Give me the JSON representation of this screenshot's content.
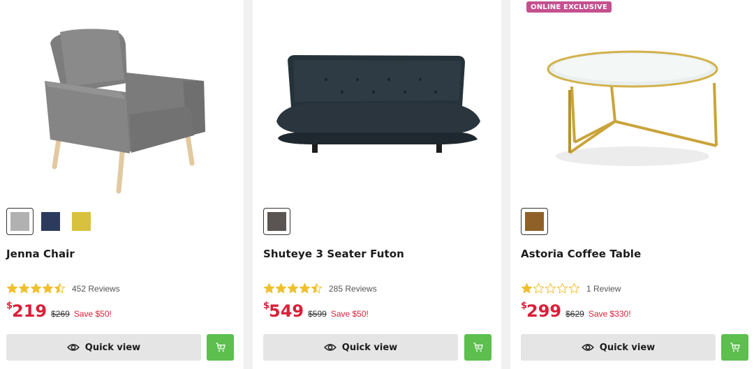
{
  "products": [
    {
      "name": "Jenna Chair",
      "badge": "",
      "swatches": [
        "#b1b1b1",
        "#2c3a5e",
        "#d8c23d"
      ],
      "selected_swatch": 0,
      "rating": 4.5,
      "reviews": "452 Reviews",
      "currency": "$",
      "price": "219",
      "was_price": "$269",
      "save": "Save $50!",
      "quick_view_label": "Quick view",
      "image_icon": "armchair-image"
    },
    {
      "name": "Shuteye 3 Seater Futon",
      "badge": "",
      "swatches": [
        "#5a5452"
      ],
      "selected_swatch": 0,
      "rating": 4.5,
      "reviews": "285 Reviews",
      "currency": "$",
      "price": "549",
      "was_price": "$599",
      "save": "Save $50!",
      "quick_view_label": "Quick view",
      "image_icon": "futon-image"
    },
    {
      "name": "Astoria Coffee Table",
      "badge": "ONLINE EXCLUSIVE",
      "swatches": [
        "#8f6128"
      ],
      "selected_swatch": 0,
      "rating": 1,
      "reviews": "1 Review",
      "currency": "$",
      "price": "299",
      "was_price": "$629",
      "save": "Save $330!",
      "quick_view_label": "Quick view",
      "image_icon": "coffee-table-image"
    }
  ],
  "colors": {
    "price": "#d9213a",
    "badge": "#c5508e",
    "cart_button": "#5cbf4e",
    "star": "#f0bf2e"
  },
  "icons": {
    "quick_view": "eye-icon",
    "cart": "cart-icon",
    "rating": "star-icon"
  }
}
